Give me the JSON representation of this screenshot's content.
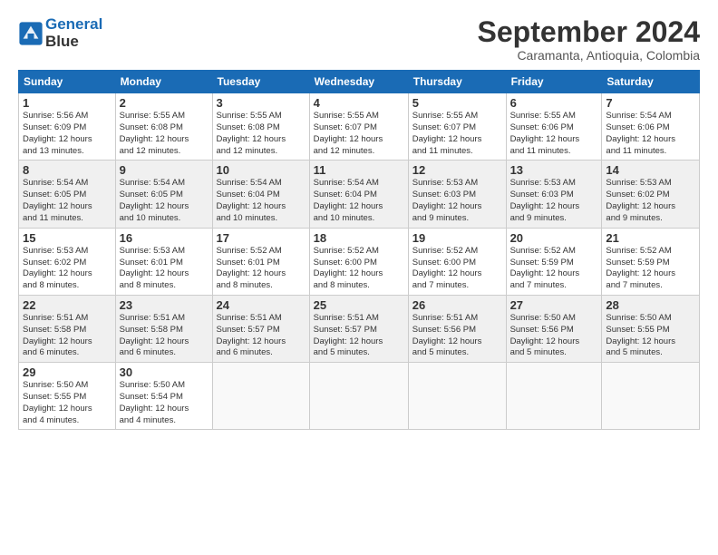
{
  "header": {
    "logo_line1": "General",
    "logo_line2": "Blue",
    "main_title": "September 2024",
    "subtitle": "Caramanta, Antioquia, Colombia"
  },
  "days_of_week": [
    "Sunday",
    "Monday",
    "Tuesday",
    "Wednesday",
    "Thursday",
    "Friday",
    "Saturday"
  ],
  "weeks": [
    [
      {
        "day": "1",
        "sunrise": "5:56 AM",
        "sunset": "6:09 PM",
        "daylight": "12 hours and 13 minutes."
      },
      {
        "day": "2",
        "sunrise": "5:55 AM",
        "sunset": "6:08 PM",
        "daylight": "12 hours and 12 minutes."
      },
      {
        "day": "3",
        "sunrise": "5:55 AM",
        "sunset": "6:08 PM",
        "daylight": "12 hours and 12 minutes."
      },
      {
        "day": "4",
        "sunrise": "5:55 AM",
        "sunset": "6:07 PM",
        "daylight": "12 hours and 12 minutes."
      },
      {
        "day": "5",
        "sunrise": "5:55 AM",
        "sunset": "6:07 PM",
        "daylight": "12 hours and 11 minutes."
      },
      {
        "day": "6",
        "sunrise": "5:55 AM",
        "sunset": "6:06 PM",
        "daylight": "12 hours and 11 minutes."
      },
      {
        "day": "7",
        "sunrise": "5:54 AM",
        "sunset": "6:06 PM",
        "daylight": "12 hours and 11 minutes."
      }
    ],
    [
      {
        "day": "8",
        "sunrise": "5:54 AM",
        "sunset": "6:05 PM",
        "daylight": "12 hours and 11 minutes."
      },
      {
        "day": "9",
        "sunrise": "5:54 AM",
        "sunset": "6:05 PM",
        "daylight": "12 hours and 10 minutes."
      },
      {
        "day": "10",
        "sunrise": "5:54 AM",
        "sunset": "6:04 PM",
        "daylight": "12 hours and 10 minutes."
      },
      {
        "day": "11",
        "sunrise": "5:54 AM",
        "sunset": "6:04 PM",
        "daylight": "12 hours and 10 minutes."
      },
      {
        "day": "12",
        "sunrise": "5:53 AM",
        "sunset": "6:03 PM",
        "daylight": "12 hours and 9 minutes."
      },
      {
        "day": "13",
        "sunrise": "5:53 AM",
        "sunset": "6:03 PM",
        "daylight": "12 hours and 9 minutes."
      },
      {
        "day": "14",
        "sunrise": "5:53 AM",
        "sunset": "6:02 PM",
        "daylight": "12 hours and 9 minutes."
      }
    ],
    [
      {
        "day": "15",
        "sunrise": "5:53 AM",
        "sunset": "6:02 PM",
        "daylight": "12 hours and 8 minutes."
      },
      {
        "day": "16",
        "sunrise": "5:53 AM",
        "sunset": "6:01 PM",
        "daylight": "12 hours and 8 minutes."
      },
      {
        "day": "17",
        "sunrise": "5:52 AM",
        "sunset": "6:01 PM",
        "daylight": "12 hours and 8 minutes."
      },
      {
        "day": "18",
        "sunrise": "5:52 AM",
        "sunset": "6:00 PM",
        "daylight": "12 hours and 8 minutes."
      },
      {
        "day": "19",
        "sunrise": "5:52 AM",
        "sunset": "6:00 PM",
        "daylight": "12 hours and 7 minutes."
      },
      {
        "day": "20",
        "sunrise": "5:52 AM",
        "sunset": "5:59 PM",
        "daylight": "12 hours and 7 minutes."
      },
      {
        "day": "21",
        "sunrise": "5:52 AM",
        "sunset": "5:59 PM",
        "daylight": "12 hours and 7 minutes."
      }
    ],
    [
      {
        "day": "22",
        "sunrise": "5:51 AM",
        "sunset": "5:58 PM",
        "daylight": "12 hours and 6 minutes."
      },
      {
        "day": "23",
        "sunrise": "5:51 AM",
        "sunset": "5:58 PM",
        "daylight": "12 hours and 6 minutes."
      },
      {
        "day": "24",
        "sunrise": "5:51 AM",
        "sunset": "5:57 PM",
        "daylight": "12 hours and 6 minutes."
      },
      {
        "day": "25",
        "sunrise": "5:51 AM",
        "sunset": "5:57 PM",
        "daylight": "12 hours and 5 minutes."
      },
      {
        "day": "26",
        "sunrise": "5:51 AM",
        "sunset": "5:56 PM",
        "daylight": "12 hours and 5 minutes."
      },
      {
        "day": "27",
        "sunrise": "5:50 AM",
        "sunset": "5:56 PM",
        "daylight": "12 hours and 5 minutes."
      },
      {
        "day": "28",
        "sunrise": "5:50 AM",
        "sunset": "5:55 PM",
        "daylight": "12 hours and 5 minutes."
      }
    ],
    [
      {
        "day": "29",
        "sunrise": "5:50 AM",
        "sunset": "5:55 PM",
        "daylight": "12 hours and 4 minutes."
      },
      {
        "day": "30",
        "sunrise": "5:50 AM",
        "sunset": "5:54 PM",
        "daylight": "12 hours and 4 minutes."
      },
      null,
      null,
      null,
      null,
      null
    ]
  ],
  "labels": {
    "sunrise": "Sunrise:",
    "sunset": "Sunset:",
    "daylight": "Daylight:"
  }
}
